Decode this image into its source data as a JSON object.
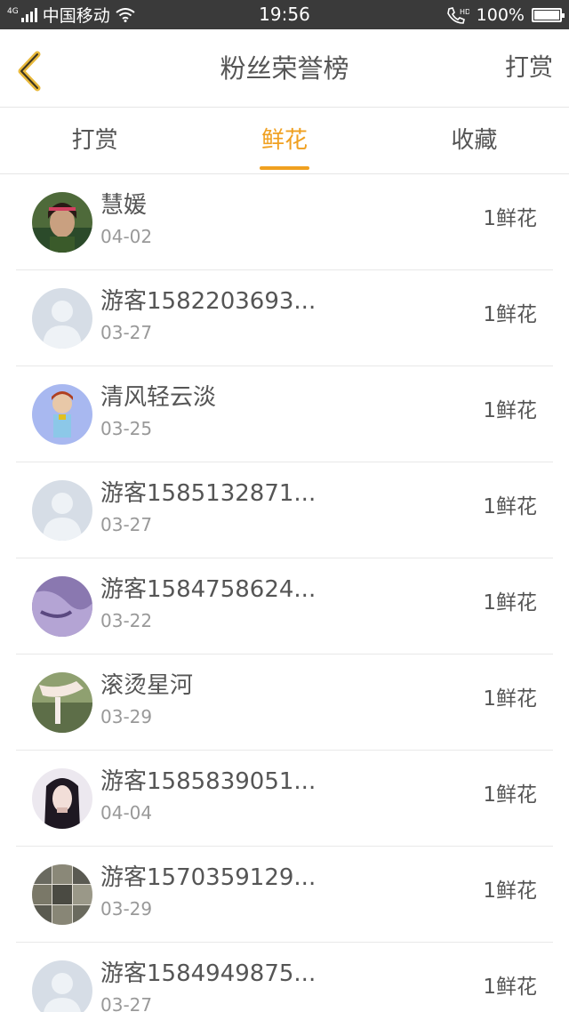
{
  "status_bar": {
    "network": "4G",
    "carrier": "中国移动",
    "time": "19:56",
    "hd_label": "HD",
    "battery": "100%",
    "battery_level": 1.0
  },
  "nav": {
    "title": "粉丝荣誉榜",
    "action": "打赏",
    "back_icon": "chevron-left-icon",
    "accent_color": "#f0a020"
  },
  "tabs": [
    {
      "label": "打赏",
      "active": false
    },
    {
      "label": "鲜花",
      "active": true
    },
    {
      "label": "收藏",
      "active": false
    }
  ],
  "list": [
    {
      "name": "慧媛",
      "date": "04-02",
      "value": "1鲜花",
      "avatar": "photo"
    },
    {
      "name": "游客1582203693...",
      "date": "03-27",
      "value": "1鲜花",
      "avatar": "default"
    },
    {
      "name": "清风轻云淡",
      "date": "03-25",
      "value": "1鲜花",
      "avatar": "photo"
    },
    {
      "name": "游客1585132871...",
      "date": "03-27",
      "value": "1鲜花",
      "avatar": "default"
    },
    {
      "name": "游客1584758624...",
      "date": "03-22",
      "value": "1鲜花",
      "avatar": "photo"
    },
    {
      "name": "滚烫星河",
      "date": "03-29",
      "value": "1鲜花",
      "avatar": "photo"
    },
    {
      "name": "游客1585839051...",
      "date": "04-04",
      "value": "1鲜花",
      "avatar": "photo"
    },
    {
      "name": "游客1570359129...",
      "date": "03-29",
      "value": "1鲜花",
      "avatar": "photo"
    },
    {
      "name": "游客1584949875...",
      "date": "03-27",
      "value": "1鲜花",
      "avatar": "default"
    }
  ]
}
